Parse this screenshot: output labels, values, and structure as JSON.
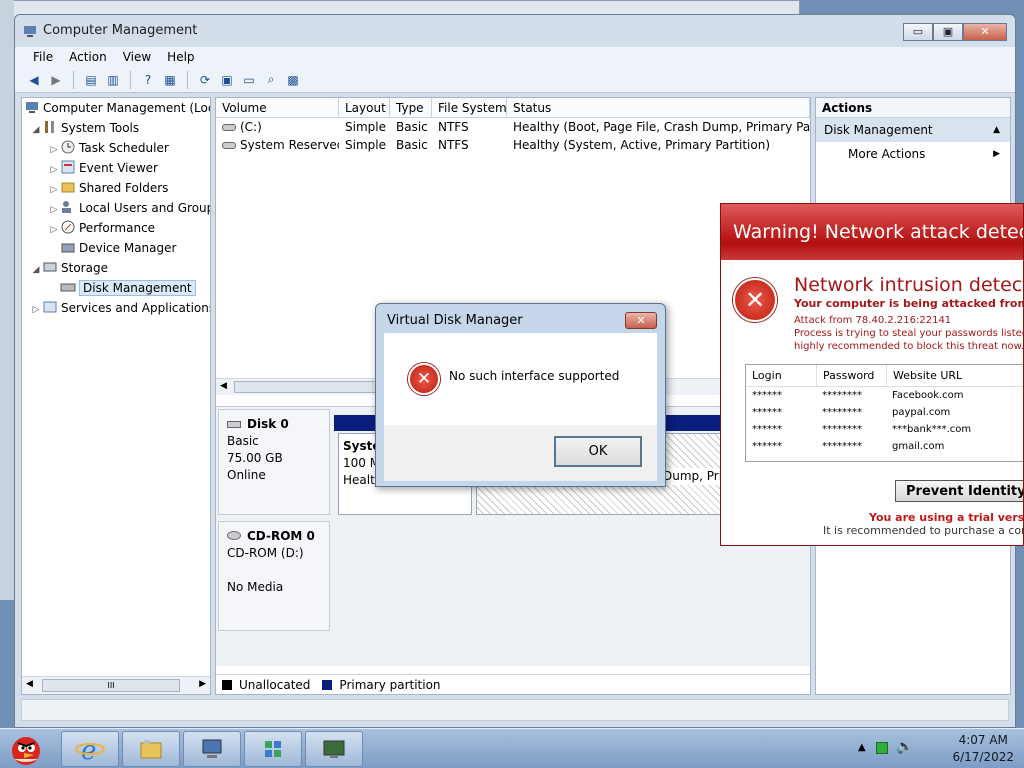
{
  "window": {
    "title": "Computer Management",
    "buttons": {
      "minimize": "▭",
      "maximize": "▣",
      "close": "✕"
    }
  },
  "menu": [
    "File",
    "Action",
    "View",
    "Help"
  ],
  "tree": {
    "root": "Computer Management (Local",
    "items": [
      {
        "label": "System Tools",
        "indent": 1,
        "exp": "◢"
      },
      {
        "label": "Task Scheduler",
        "indent": 2,
        "exp": "▷"
      },
      {
        "label": "Event Viewer",
        "indent": 2,
        "exp": "▷"
      },
      {
        "label": "Shared Folders",
        "indent": 2,
        "exp": "▷"
      },
      {
        "label": "Local Users and Groups",
        "indent": 2,
        "exp": "▷"
      },
      {
        "label": "Performance",
        "indent": 2,
        "exp": "▷"
      },
      {
        "label": "Device Manager",
        "indent": 2,
        "exp": ""
      },
      {
        "label": "Storage",
        "indent": 1,
        "exp": "◢"
      },
      {
        "label": "Disk Management",
        "indent": 2,
        "exp": ""
      },
      {
        "label": "Services and Applications",
        "indent": 1,
        "exp": "▷"
      }
    ],
    "scroll_grip": "III"
  },
  "volumes": {
    "headers": [
      "Volume",
      "Layout",
      "Type",
      "File System",
      "Status"
    ],
    "rows": [
      [
        "(C:)",
        "Simple",
        "Basic",
        "NTFS",
        "Healthy (Boot, Page File, Crash Dump, Primary Part"
      ],
      [
        "System Reserved",
        "Simple",
        "Basic",
        "NTFS",
        "Healthy (System, Active, Primary Partition)"
      ]
    ]
  },
  "disks": {
    "disk0": {
      "name": "Disk 0",
      "type": "Basic",
      "size": "75.00 GB",
      "state": "Online"
    },
    "part1": {
      "name": "Systen",
      "size": "100 M",
      "status": "Health"
    },
    "part2": {
      "status": "Dump, Pri"
    },
    "cdrom": {
      "name": "CD-ROM 0",
      "label": "CD-ROM (D:)",
      "media": "No Media"
    }
  },
  "legend": {
    "unallocated": "Unallocated",
    "primary": "Primary partition"
  },
  "actions": {
    "header": "Actions",
    "section": "Disk Management",
    "more": "More Actions"
  },
  "dialog": {
    "title": "Virtual Disk Manager",
    "message": "No such interface supported",
    "ok": "OK",
    "close": "✕"
  },
  "warning": {
    "header": "Warning! Network attack detect",
    "title": "Network intrusion detect",
    "subtitle": "Your computer is being attacked from a r",
    "attack": "Attack from 78.40.2.216:22141",
    "line1": "Process is trying to steal your passwords listed b",
    "line2": "highly recommended to block this threat now.",
    "table_headers": [
      "Login",
      "Password",
      "Website URL"
    ],
    "rows": [
      [
        "******",
        "********",
        "Facebook.com"
      ],
      [
        "******",
        "********",
        "paypal.com"
      ],
      [
        "******",
        "********",
        "***bank***.com"
      ],
      [
        "******",
        "********",
        "gmail.com"
      ]
    ],
    "button": "Prevent Identity T",
    "trial1": "You are using a trial version",
    "trial2": "It is recommended to purchase a commerc"
  },
  "taskbar": {
    "time": "4:07 AM",
    "date": "6/17/2022"
  },
  "colors": {
    "primary_partition": "#0b1d7d",
    "warning_red": "#b30f0f"
  }
}
